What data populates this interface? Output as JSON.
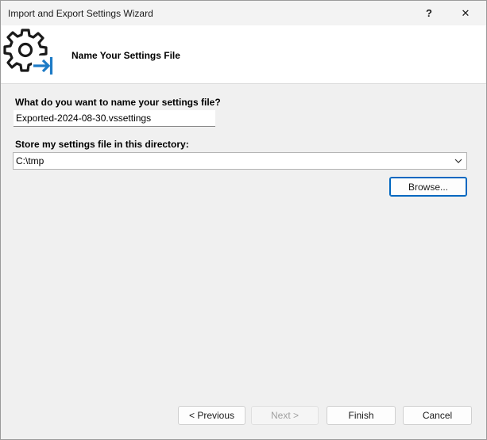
{
  "window": {
    "title": "Import and Export Settings Wizard",
    "help_label": "?",
    "close_label": "✕"
  },
  "header": {
    "title": "Name Your Settings File",
    "icon": "gear-export-icon",
    "icon_accent_color": "#1e7bc6"
  },
  "form": {
    "name_label": "What do you want to name your settings file?",
    "name_value": "Exported-2024-08-30.vssettings",
    "directory_label": "Store my settings file in this directory:",
    "directory_value": "C:\\tmp",
    "browse_label": "Browse..."
  },
  "footer": {
    "previous_label": "< Previous",
    "next_label": "Next >",
    "finish_label": "Finish",
    "cancel_label": "Cancel"
  }
}
